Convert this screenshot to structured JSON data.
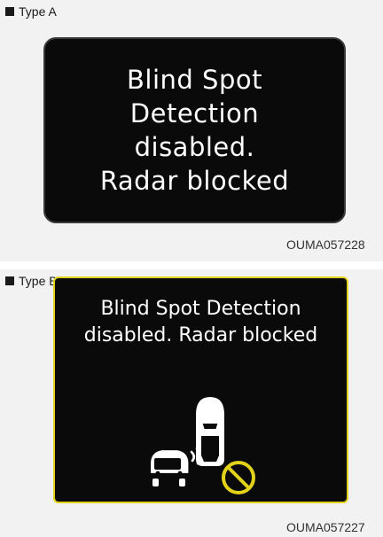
{
  "panels": [
    {
      "label": "Type A",
      "message_lines": [
        "Blind Spot",
        "Detection",
        "disabled.",
        "Radar blocked"
      ],
      "code": "OUMA057228"
    },
    {
      "label": "Type B",
      "message_lines": [
        "Blind Spot Detection",
        "disabled. Radar blocked"
      ],
      "code": "OUMA057227",
      "icon": "car-radar-blocked-icon"
    }
  ],
  "colors": {
    "screen": "#0a0a0a",
    "text": "#ffffff",
    "type_b_border": "#e3d21a",
    "prohibit": "#e3d21a"
  }
}
